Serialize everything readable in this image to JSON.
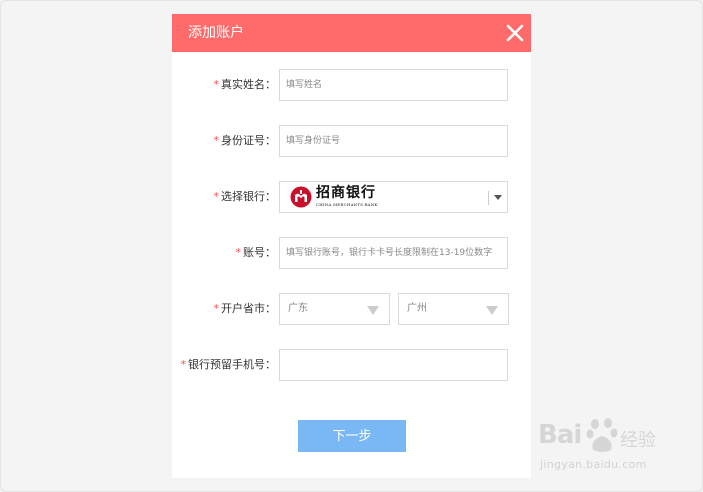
{
  "dialog": {
    "title": "添加账户",
    "next_label": "下一步"
  },
  "form": {
    "name": {
      "label": "真实姓名：",
      "placeholder": "填写姓名"
    },
    "id_card": {
      "label": "身份证号：",
      "placeholder": "填写身份证号"
    },
    "bank": {
      "label": "选择银行：",
      "selected_cn": "招商银行",
      "selected_en": "CHINA MERCHANTS BANK"
    },
    "account": {
      "label": "账号：",
      "placeholder": "填写银行账号，银行卡卡号长度限制在13-19位数字"
    },
    "region": {
      "label": "开户省市：",
      "province": "广东",
      "city": "广州"
    },
    "phone": {
      "label": "银行预留手机号：",
      "placeholder": ""
    },
    "required_mark": "*"
  },
  "watermark": {
    "brand": "Bai",
    "brand_cn": "经验",
    "url": "jingyan.baidu.com"
  },
  "colors": {
    "header": "#ff6a6a",
    "button": "#7ab8f5",
    "required": "#ff4b4b",
    "bank_logo": "#c8102e"
  }
}
